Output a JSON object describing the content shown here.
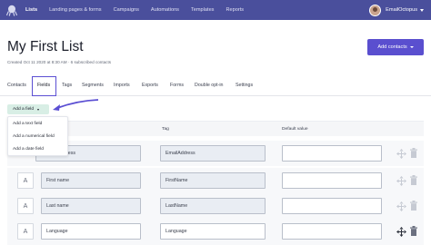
{
  "colors": {
    "nav_bg": "#4a4f9c",
    "accent": "#5a4fcf",
    "add_field_bg": "#d8eee5",
    "highlight": "#5b4fd3"
  },
  "nav": {
    "items": [
      {
        "label": "Lists",
        "active": true
      },
      {
        "label": "Landing pages & forms",
        "active": false
      },
      {
        "label": "Campaigns",
        "active": false
      },
      {
        "label": "Automations",
        "active": false
      },
      {
        "label": "Templates",
        "active": false
      },
      {
        "label": "Reports",
        "active": false
      }
    ],
    "user_name": "EmailOctopus"
  },
  "page": {
    "title": "My First List",
    "subtitle": "Created Oct 11 2020 at 8:30 AM  ·  6 subscribed contacts",
    "add_contacts_label": "Add contacts"
  },
  "tabs": [
    {
      "label": "Contacts"
    },
    {
      "label": "Fields",
      "active": true
    },
    {
      "label": "Tags"
    },
    {
      "label": "Segments"
    },
    {
      "label": "Imports"
    },
    {
      "label": "Exports"
    },
    {
      "label": "Forms"
    },
    {
      "label": "Double opt-in"
    },
    {
      "label": "Settings"
    }
  ],
  "add_field": {
    "label": "Add a field",
    "menu": [
      "Add a text field",
      "Add a numerical field",
      "Add a date field"
    ]
  },
  "table": {
    "headers": {
      "name": "",
      "tag": "Tag",
      "default": "Default value"
    },
    "rows": [
      {
        "type": "",
        "name": "ress",
        "tag": "EmailAddress",
        "default": "",
        "editable_name": false
      },
      {
        "type": "A",
        "name": "First name",
        "tag": "FirstName",
        "default": "",
        "editable_name": false
      },
      {
        "type": "A",
        "name": "Last name",
        "tag": "LastName",
        "default": "",
        "editable_name": false
      },
      {
        "type": "A",
        "name": "Language",
        "tag": "Language",
        "default": "",
        "editable_name": true
      }
    ]
  },
  "icons": {
    "logo": "octopus-icon",
    "drag": "move-icon",
    "delete": "trash-icon"
  }
}
